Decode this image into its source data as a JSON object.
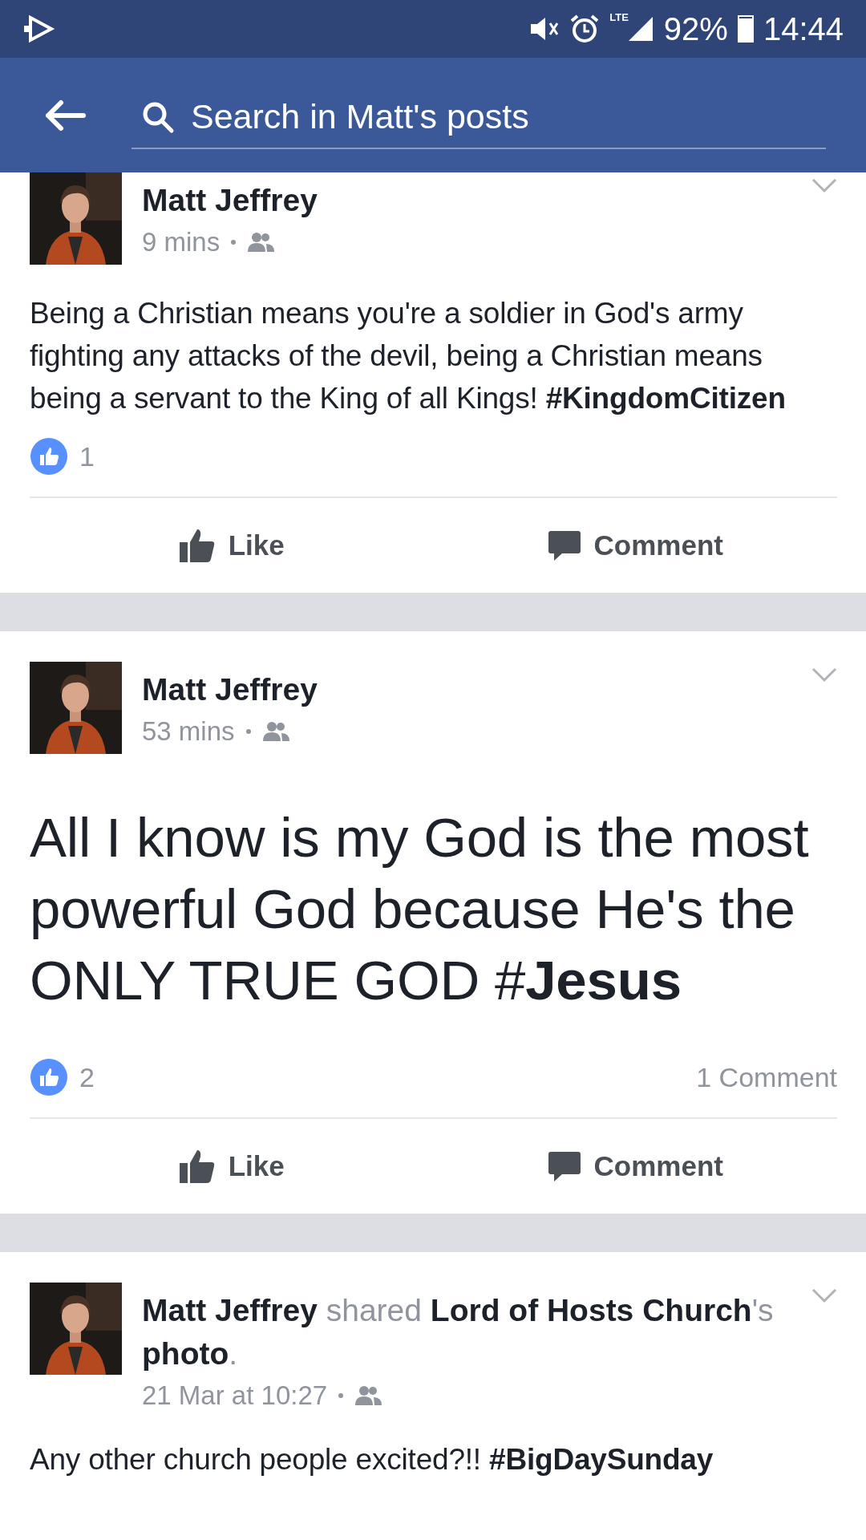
{
  "status_bar": {
    "network": "LTE",
    "battery": "92%",
    "time": "14:44"
  },
  "search": {
    "placeholder": "Search in Matt's posts"
  },
  "posts": [
    {
      "kind": "text",
      "headline": "**Matt Jeffrey**",
      "time": "9 mins",
      "text": "Being a Christian means you're a soldier in God's army fighting any attacks of the devil, being a Christian means being a servant to the King of all Kings! **#KingdomCitizen**",
      "likes": "1",
      "actions": [
        "Like",
        "Comment"
      ]
    },
    {
      "kind": "large_text",
      "headline": "**Matt Jeffrey**",
      "time": "53 mins",
      "text": "All I know is my God is the most powerful God because He's the ONLY TRUE GOD #**Jesus**",
      "likes": "2",
      "comments": "1 Comment",
      "actions": [
        "Like",
        "Comment"
      ]
    },
    {
      "kind": "text",
      "headline": "**Matt Jeffrey** shared **Lord of Hosts Church**'s **photo**.",
      "time": "21 Mar at 10:27",
      "text": "Any other church people excited?!! **#BigDaySunday**"
    }
  ]
}
